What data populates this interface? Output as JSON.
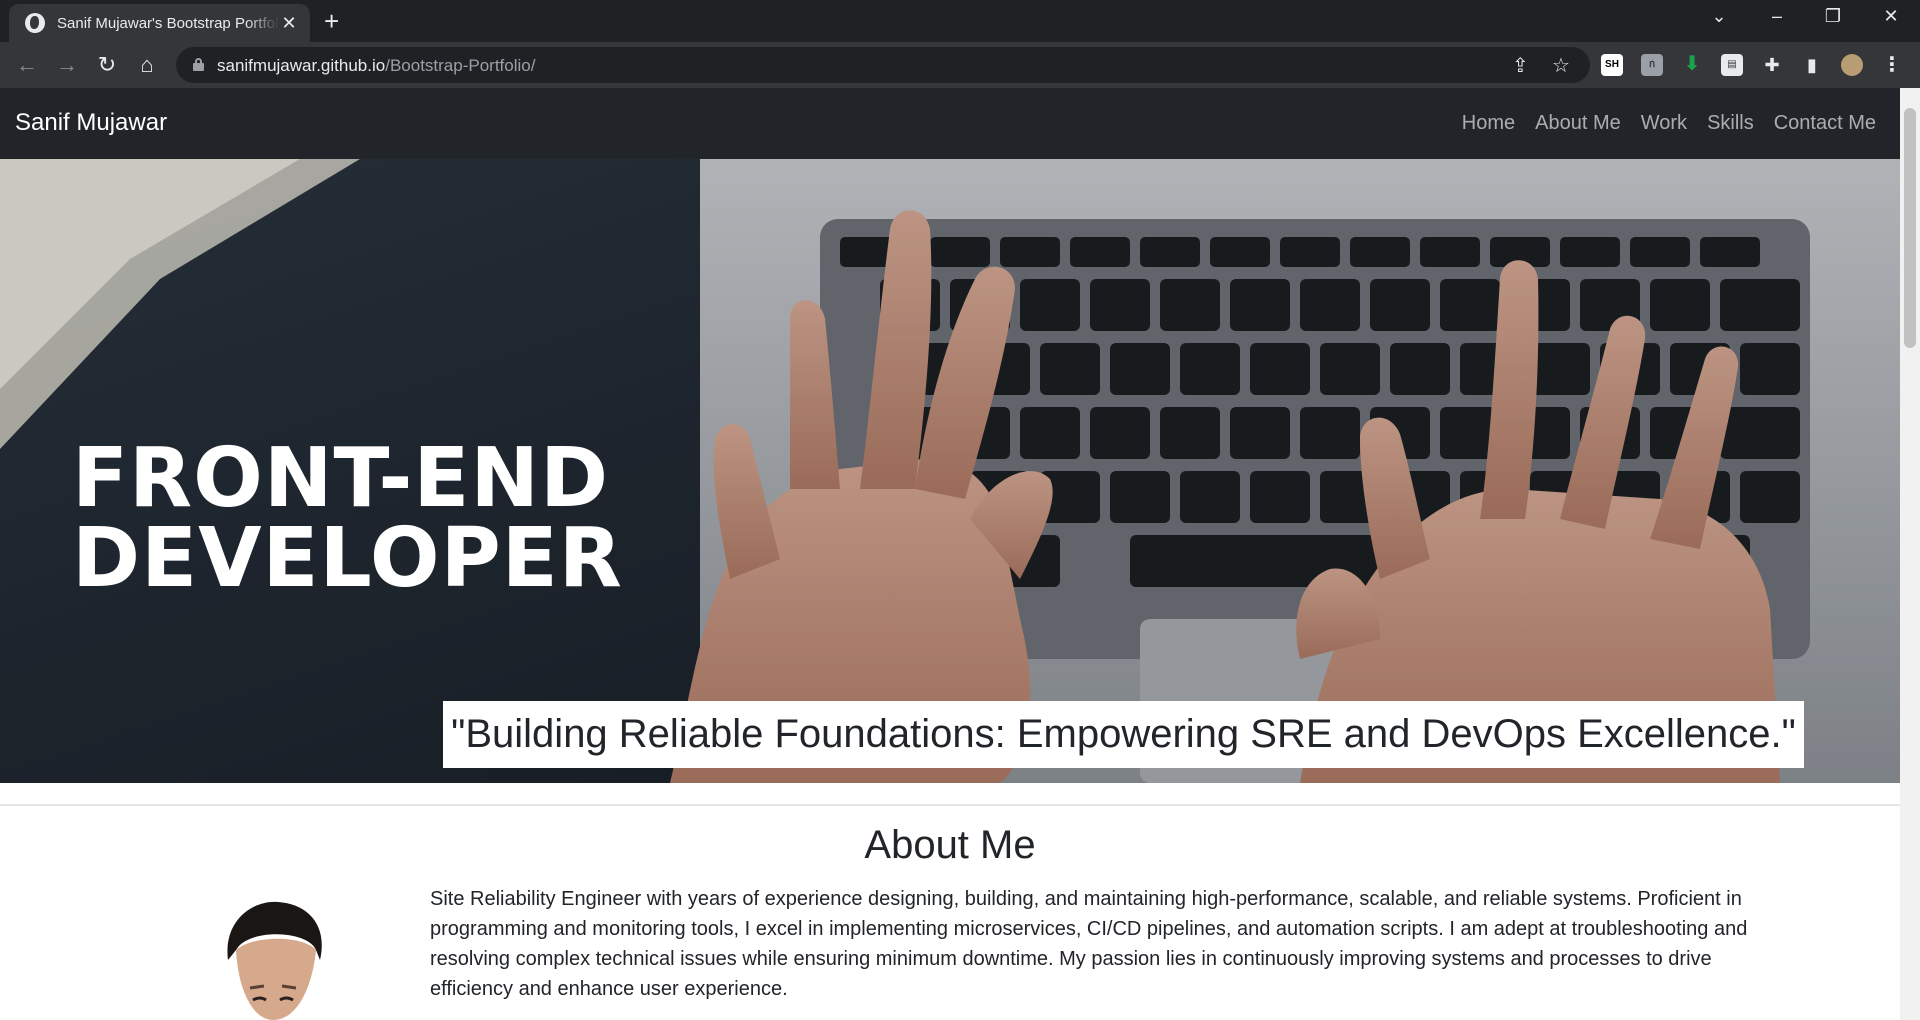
{
  "browser": {
    "tab_title": "Sanif Mujawar's Bootstrap Portfolio",
    "tab_close": "✕",
    "new_tab": "+",
    "url_host": "sanifmujawar.github.io",
    "url_path": "/Bootstrap-Portfolio/",
    "extension_sh_label": "SH"
  },
  "navbar": {
    "brand": "Sanif Mujawar",
    "links": [
      {
        "label": "Home"
      },
      {
        "label": "About Me"
      },
      {
        "label": "Work"
      },
      {
        "label": "Skills"
      },
      {
        "label": "Contact Me"
      }
    ]
  },
  "hero": {
    "title_line1": "FRONT-END",
    "title_line2": "DEVELOPER",
    "quote": "\"Building Reliable Foundations: Empowering SRE and DevOps Excellence.\""
  },
  "about": {
    "title": "About Me",
    "text": "Site Reliability Engineer with years of experience designing, building, and maintaining high-performance, scalable, and reliable systems. Proficient in programming and monitoring tools, I excel in implementing microservices, CI/CD pipelines, and automation scripts. I am adept at troubleshooting and resolving complex technical issues while ensuring minimum downtime. My passion lies in continuously improving systems and processes to drive efficiency and enhance user experience."
  },
  "colors": {
    "navbar_bg": "#212529",
    "chrome_bg": "#202124",
    "toolbar_bg": "#35363a",
    "text": "#212529"
  }
}
